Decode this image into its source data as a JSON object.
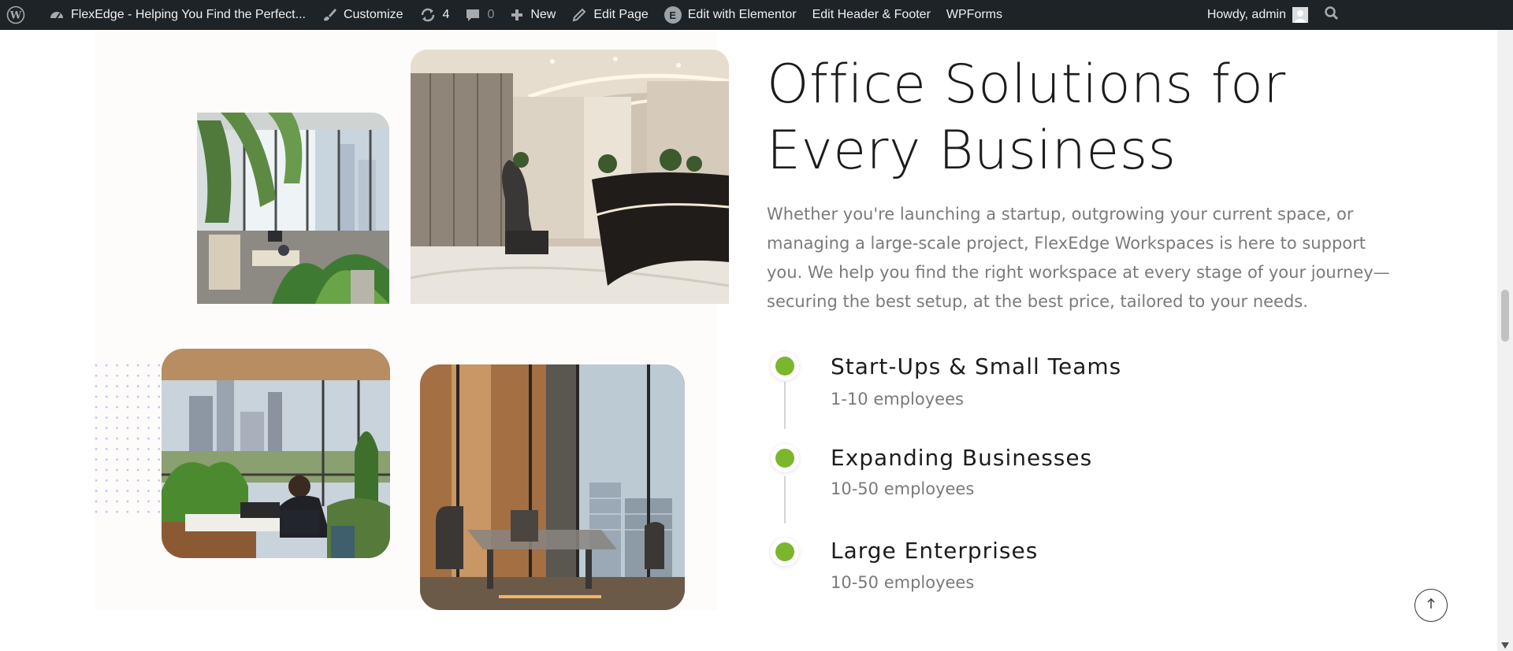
{
  "admin_bar": {
    "site_name": "FlexEdge - Helping You Find the Perfect...",
    "customize": "Customize",
    "updates_count": "4",
    "comments_count": "0",
    "new": "New",
    "edit_page": "Edit Page",
    "edit_elementor": "Edit with Elementor",
    "elementor_badge": "E",
    "edit_header_footer": "Edit Header & Footer",
    "wpforms": "WPForms",
    "greeting": "Howdy, admin",
    "icons": [
      "wordpress-logo-icon",
      "dashboard-icon",
      "brush-icon",
      "refresh-icon",
      "comment-icon",
      "plus-icon",
      "pencil-icon",
      "elementor-icon",
      "avatar-icon",
      "search-icon"
    ]
  },
  "section": {
    "heading": "Office Solutions for Every Business",
    "intro": "Whether you're launching a startup, outgrowing your current space, or managing a large-scale project, FlexEdge Workspaces is here to support you. We help you find the right workspace at every stage of your journey—securing the best setup, at the best price, tailored to your needs.",
    "accent_color": "#7ab72c",
    "items": [
      {
        "title": "Start-Ups & Small Teams",
        "subtitle": "1-10 employees"
      },
      {
        "title": "Expanding Businesses",
        "subtitle": "10-50 employees"
      },
      {
        "title": "Large Enterprises",
        "subtitle": "10-50 employees"
      }
    ],
    "images": [
      "office-plants-photo",
      "reception-lobby-photo",
      "terrace-workspace-photo",
      "glass-meeting-room-photo"
    ]
  },
  "scroll_top_icon": "arrow-up-icon"
}
